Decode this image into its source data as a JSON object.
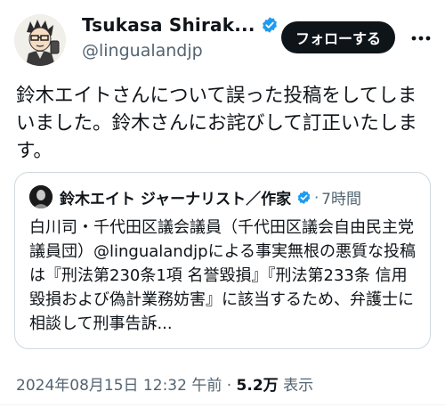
{
  "author": {
    "display_name": "Tsukasa Shirak...",
    "handle": "@lingualandjp",
    "avatar_icon": "cartoon-portrait-avatar",
    "verified_icon": "verified-badge-icon"
  },
  "follow_button": {
    "label": "フォローする"
  },
  "more_menu": {
    "icon": "more-horizontal-icon"
  },
  "tweet": {
    "text": "鈴木エイトさんについて誤った投稿をしてしまいました。鈴木さんにお詫びして訂正いたします。"
  },
  "quoted_tweet": {
    "author_name": "鈴木エイト ジャーナリスト／作家",
    "separator": "·",
    "time": "7時間",
    "text": "白川司・千代田区議会議員（千代田区議会自由民主党議員団）@lingualandjpによる事実無根の悪質な投稿は『刑法第230条1項 名誉毀損』『刑法第233条 信用毀損および偽計業務妨害』に該当するため、弁護士に相談して刑事告訴..."
  },
  "meta": {
    "timestamp": "2024年08月15日 12:32 午前",
    "separator": "·",
    "views_count": "5.2万",
    "views_label": "表示"
  },
  "colors": {
    "text_primary": "#0f1419",
    "text_secondary": "#536471",
    "verified_blue": "#1d9bf0",
    "button_dark": "#0f1419",
    "border": "#cfd9de"
  }
}
